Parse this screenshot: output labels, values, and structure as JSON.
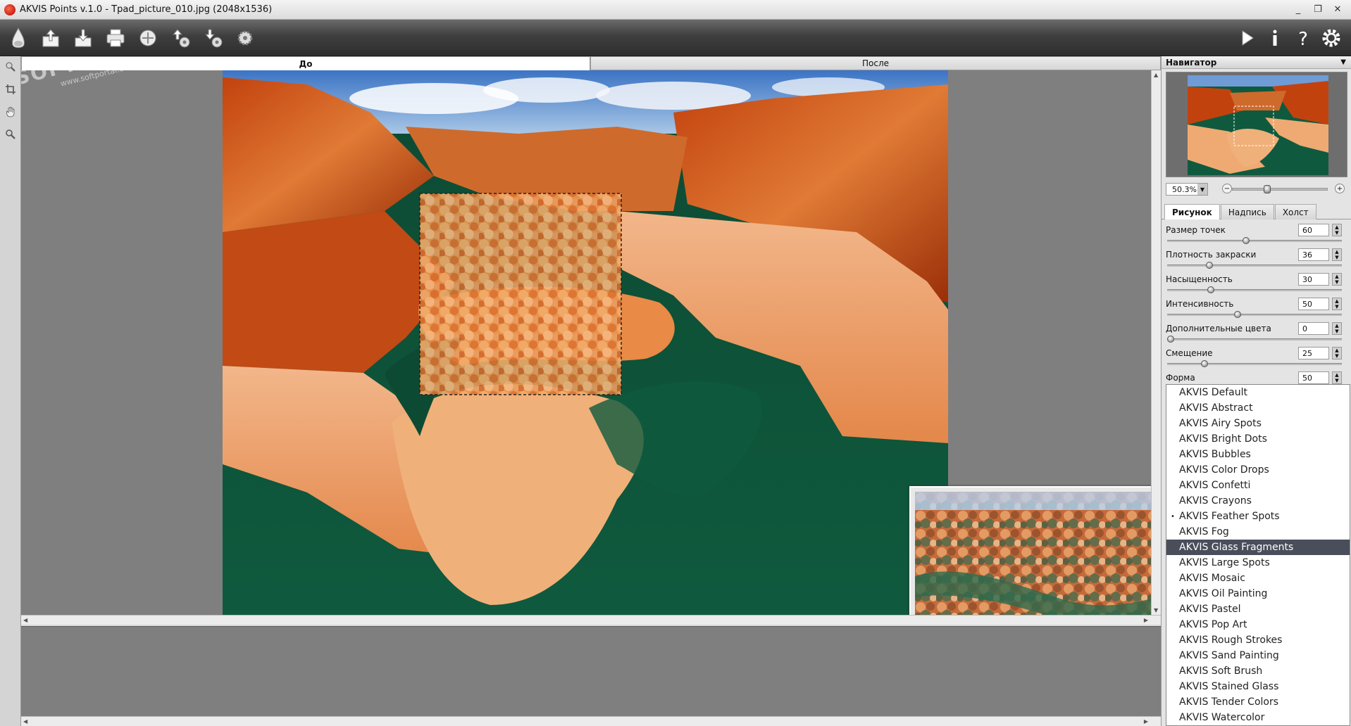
{
  "window": {
    "title": "AKVIS Points v.1.0 - Tpad_picture_010.jpg (2048x1536)",
    "controls": [
      "_",
      "❐",
      "✕"
    ]
  },
  "toolbar": {
    "left_buttons": [
      "logo-icon",
      "open-icon",
      "save-icon",
      "print-icon",
      "share-icon",
      "import-presets-icon",
      "export-presets-icon",
      "settings-batch-icon"
    ],
    "right_buttons": [
      "run-icon",
      "info-icon",
      "help-icon",
      "preferences-icon"
    ]
  },
  "view_tabs": {
    "before": "До",
    "after": "После"
  },
  "colors": {
    "accent_selected": "#4a4d5a",
    "toolbar_dark": "#2e2e2e"
  },
  "navigator": {
    "header": "Навигатор",
    "zoom": "50.3%"
  },
  "param_tabs": {
    "picture": "Рисунок",
    "text": "Надпись",
    "canvas": "Холст"
  },
  "params": [
    {
      "label": "Размер точек",
      "value": "60",
      "level": 0.45
    },
    {
      "label": "Плотность закраски",
      "value": "36",
      "level": 0.23
    },
    {
      "label": "Насыщенность",
      "value": "30",
      "level": 0.24
    },
    {
      "label": "Интенсивность",
      "value": "50",
      "level": 0.4
    },
    {
      "label": "Дополнительные цвета",
      "value": "0",
      "level": 0.0
    },
    {
      "label": "Смещение",
      "value": "25",
      "level": 0.2
    },
    {
      "label": "Форма",
      "value": "50",
      "level": 0.5
    }
  ],
  "presets": {
    "items": [
      "AKVIS Default",
      "AKVIS Abstract",
      "AKVIS Airy Spots",
      "AKVIS Bright Dots",
      "AKVIS Bubbles",
      "AKVIS Color Drops",
      "AKVIS Confetti",
      "AKVIS Crayons",
      "AKVIS Feather Spots",
      "AKVIS Fog",
      "AKVIS Glass Fragments",
      "AKVIS Large Spots",
      "AKVIS Mosaic",
      "AKVIS Oil Painting",
      "AKVIS Pastel",
      "AKVIS Pop Art",
      "AKVIS Rough Strokes",
      "AKVIS Sand Painting",
      "AKVIS Soft Brush",
      "AKVIS Stained Glass",
      "AKVIS Tender Colors",
      "AKVIS Watercolor"
    ],
    "selected_index": 10,
    "marked_index": 8,
    "mark": "•"
  },
  "watermark": {
    "text": "SOFTPORTAL",
    "url": "www.softportal.com"
  }
}
